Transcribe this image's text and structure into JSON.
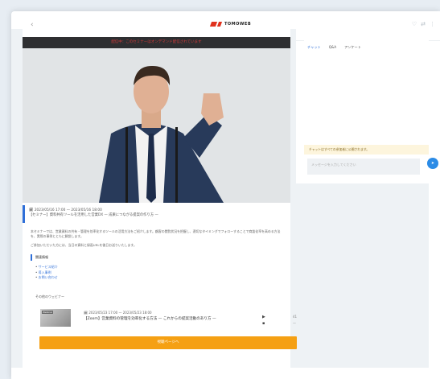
{
  "header": {
    "logo_text": "TOMOWEB",
    "back_icon": "chevron-left-icon",
    "icons": [
      "heart-icon",
      "share-icon",
      "more-icon"
    ]
  },
  "video": {
    "banner_text": "配信中：このセミナーはオンデマンド配信されています"
  },
  "meta": {
    "line1": "🗓 2023/05/16 17:00 — 2023/05/16 18:00",
    "line2": "【セミナー】資料共有ツールを活用した営業DX — 成果につながる提案の作り方 —"
  },
  "description": {
    "para1": "本セミナーでは、営業資料の共有・管理を効率化するツールの活用方法をご紹介します。顧客の閲覧状況を把握し、適切なタイミングでフォローすることで商談化率を高める方法を、実際の事例とともに解説します。",
    "para2": "ご参加いただいた方には、当日の資料と録画URLを後日お送りいたします。"
  },
  "sub_heading": "関連情報",
  "links": [
    "サービス紹介",
    "導入事例",
    "お問い合わせ"
  ],
  "related": {
    "title": "その他のウェビナー",
    "item": {
      "thumb_tag": "Webinar",
      "when": "🗓 2023/05/23 17:00 — 2023/05/23 18:00",
      "title": "【Zoom】営業資料の管理を効率化する方法 — これからの提案活動のあり方 —",
      "icons": [
        "play-icon",
        "list-icon"
      ],
      "count_top": "41",
      "count_bottom": "—"
    }
  },
  "cta_label": "視聴ページへ",
  "side": {
    "tabs": [
      {
        "label": "チャット",
        "active": true
      },
      {
        "label": "Q&A",
        "active": false
      },
      {
        "label": "アンケート",
        "active": false
      }
    ],
    "notice": "チャットはすべての参加者に公開されます。",
    "input_placeholder": "メッセージを入力してください",
    "send_label": "送信"
  },
  "colors": {
    "accent": "#2f6fd8",
    "cta": "#f5a013",
    "logo": "#e0321d"
  }
}
